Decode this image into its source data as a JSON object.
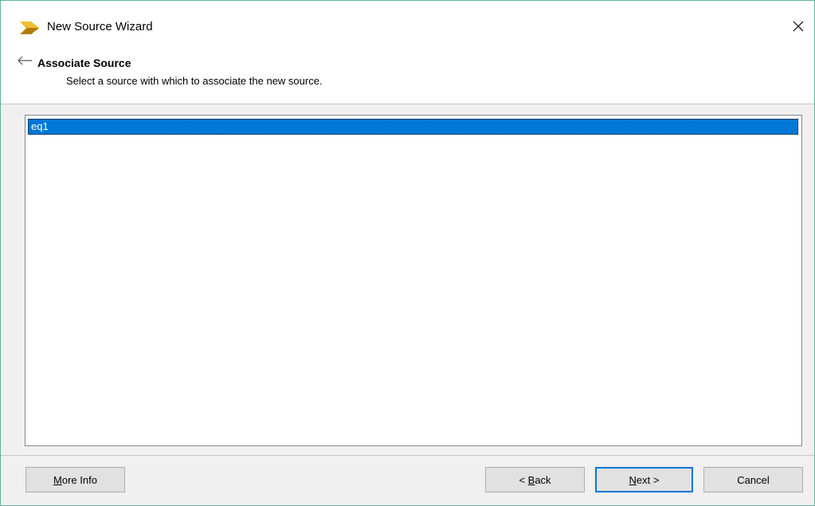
{
  "window": {
    "title": "New Source Wizard",
    "icon": "vivado-chevron-icon",
    "accent_color": "#0078d7",
    "close_icon": "close-icon"
  },
  "header": {
    "heading": "Associate Source",
    "subtitle": "Select a source with which to associate the new source.",
    "back_icon": "back-arrow-icon"
  },
  "sources": {
    "items": [
      {
        "label": "eq1",
        "selected": true
      }
    ]
  },
  "buttons": {
    "more_info": {
      "label": "More Info",
      "mnemonic": "M",
      "rest": "ore Info"
    },
    "back": {
      "label": "< Back",
      "prefix": "< ",
      "mnemonic": "B",
      "rest": "ack"
    },
    "next": {
      "label": "Next >",
      "mnemonic": "N",
      "rest": "ext >"
    },
    "cancel": {
      "label": "Cancel"
    }
  }
}
